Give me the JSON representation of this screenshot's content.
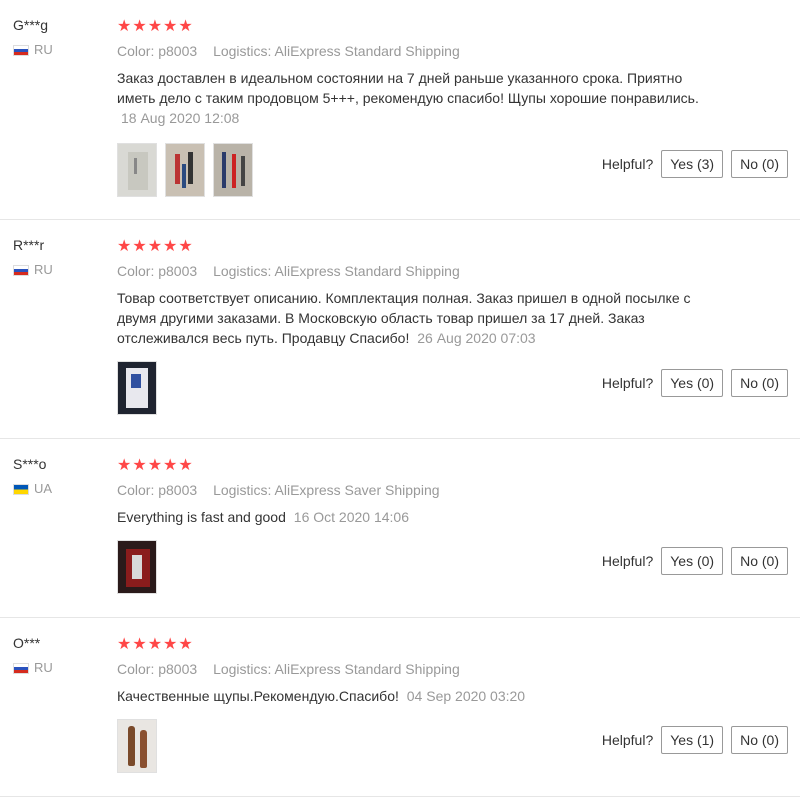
{
  "reviews": [
    {
      "user": "G***g",
      "country": "RU",
      "stars": "★★★★★",
      "color": "Color: p8003",
      "logistics": "Logistics: AliExpress Standard Shipping",
      "text": "Заказ доставлен в идеальном состоянии на 7 дней раньше указанного срока. Приятно иметь дело с таким продовцом 5+++, рекомендую спасибо! Щупы хорошие понравились.",
      "date": "18 Aug 2020 12:08",
      "helpful": "Helpful?",
      "yes": "Yes (3)",
      "no": "No (0)"
    },
    {
      "user": "R***r",
      "country": "RU",
      "stars": "★★★★★",
      "color": "Color: p8003",
      "logistics": "Logistics: AliExpress Standard Shipping",
      "text": "Товар соответствует описанию. Комплектация полная. Заказ пришел в одной посылке с двумя другими заказами. В Московскую область товар пришел за 17 дней. Заказ отслеживался весь путь. Продавцу Спасибо!",
      "date": "26 Aug 2020 07:03",
      "helpful": "Helpful?",
      "yes": "Yes (0)",
      "no": "No (0)"
    },
    {
      "user": "S***o",
      "country": "UA",
      "stars": "★★★★★",
      "color": "Color: p8003",
      "logistics": "Logistics: AliExpress Saver Shipping",
      "text": "Everything is fast and good",
      "date": "16 Oct 2020 14:06",
      "helpful": "Helpful?",
      "yes": "Yes (0)",
      "no": "No (0)"
    },
    {
      "user": "O***",
      "country": "RU",
      "stars": "★★★★★",
      "color": "Color: p8003",
      "logistics": "Logistics: AliExpress Standard Shipping",
      "text": "Качественные щупы.Рекомендую.Спасибо!",
      "date": "04 Sep 2020 03:20",
      "helpful": "Helpful?",
      "yes": "Yes (1)",
      "no": "No (0)"
    }
  ],
  "colors": {
    "star": "#ff4747",
    "meta": "#999999",
    "text": "#333333"
  }
}
